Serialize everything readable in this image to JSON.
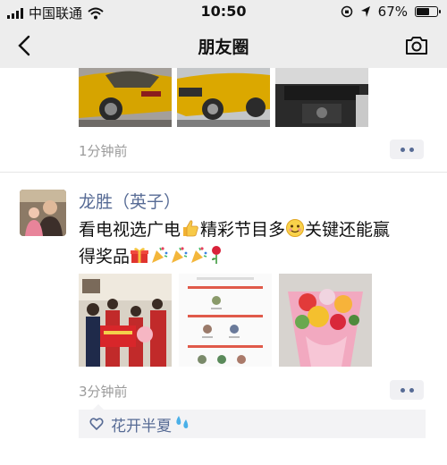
{
  "status_bar": {
    "carrier": "中国联通",
    "time": "10:50",
    "battery_text": "67%",
    "battery_level": 0.67,
    "icons": [
      "signal-icon",
      "wifi-icon",
      "orientation-lock-icon",
      "location-icon",
      "battery-icon"
    ]
  },
  "nav": {
    "title": "朋友圈",
    "back_icon": "chevron-left-icon",
    "camera_icon": "camera-icon"
  },
  "posts": [
    {
      "time": "1分钟前",
      "images": [
        "yellow-car-rear",
        "yellow-car-front",
        "car-interior"
      ]
    },
    {
      "author": "龙胜（英子）",
      "text_line1": "看电视选广电",
      "text_line1b": "精彩节目多",
      "text_line1c": "关键还能赢",
      "text_line2": "得奖品",
      "emojis": [
        "thumbs-up",
        "smile",
        "gift",
        "party-popper",
        "rose"
      ],
      "images": [
        "prize-photo-group",
        "prize-winner-list",
        "flower-bouquet"
      ],
      "time": "3分钟前",
      "likes_icon": "heart-outline-icon",
      "likes": "花开半夏"
    }
  ],
  "colors": {
    "link": "#576b95",
    "time": "#9b9b9b",
    "nav_bg": "#ededed"
  }
}
